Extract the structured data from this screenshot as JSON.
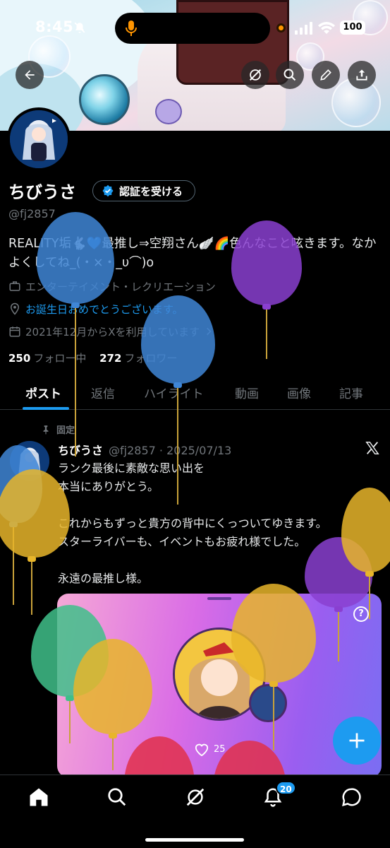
{
  "status_bar": {
    "time": "8:45",
    "battery": "100"
  },
  "profile": {
    "name": "ちびうさ",
    "verify_label": "認証を受ける",
    "handle": "@fj2857",
    "bio": "REALITY垢🐇💙最推し⇒空翔さん🪽🌈色んなこと呟きます。なかよくしてね_(・×・_υ⌒)o",
    "category": "エンターテイメント・レクリエーション",
    "birthday_note": "お誕生日おめでとうございます。",
    "joined": "2021年12月からXを利用しています",
    "following_count": "250",
    "following_label": "フォロー中",
    "followers_count": "272",
    "followers_label": "フォロワー"
  },
  "tabs": [
    "ポスト",
    "返信",
    "ハイライト",
    "動画",
    "画像",
    "記事"
  ],
  "pinned_tweet": {
    "pin_label": "固定",
    "author_name": "ちびうさ",
    "author_handle": "@fj2857",
    "date": "2025/07/13",
    "text": "ランク最後に素敵な思い出を\n本当にありがとう。\n\nこれからもずっと貴方の背中にくっついてゆきます。\nスターライバーも、イベントもお疲れ様でした。\n\n永遠の最推し様。",
    "card_stat": "25"
  },
  "notifications_badge": "20",
  "colors": {
    "accent": "#1d9bf0",
    "background": "#000000",
    "muted": "#71767b"
  },
  "icons": [
    "back-arrow-icon",
    "grok-icon",
    "search-icon",
    "edit-icon",
    "share-icon",
    "home-icon",
    "notifications-icon",
    "messages-icon",
    "plus-icon"
  ]
}
